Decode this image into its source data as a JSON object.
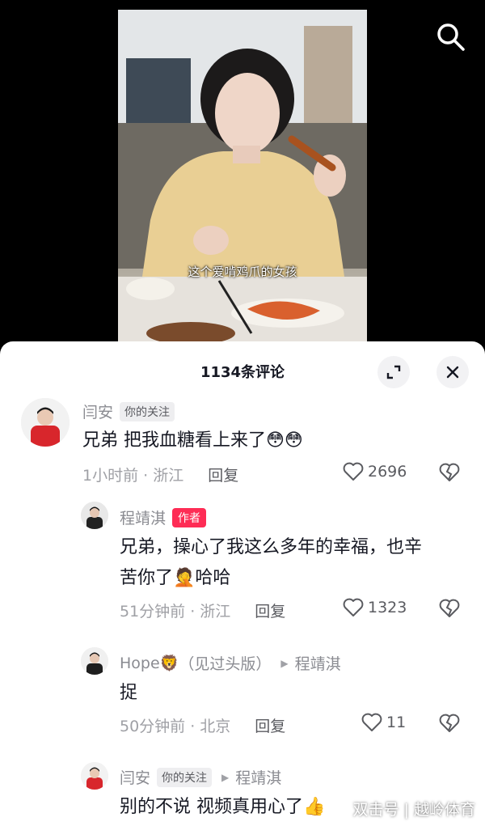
{
  "video": {
    "caption": "这个爱啃鸡爪的女孩"
  },
  "header": {
    "title": "1134条评论"
  },
  "comments": [
    {
      "author": "闫安",
      "tag": "你的关注",
      "text": "兄弟 把我血糖看上来了😳😳",
      "time_location": "1小时前 · 浙江",
      "reply_label": "回复",
      "likes": "2696"
    },
    {
      "author": "程靖淇",
      "tag": "作者",
      "text_line1": "兄弟，操心了我这么多年的幸福，也辛",
      "text_line2": "苦你了🤦哈哈",
      "time_location": "51分钟前 · 浙江",
      "reply_label": "回复",
      "likes": "1323"
    },
    {
      "author": "Hope🦁",
      "author_suffix": "（见过头版）",
      "reply_to": "程靖淇",
      "text": "捉",
      "time_location": "50分钟前 · 北京",
      "reply_label": "回复",
      "likes": "11"
    },
    {
      "author": "闫安",
      "tag": "你的关注",
      "reply_to": "程靖淇",
      "text": "别的不说 视频真用心了👍"
    }
  ],
  "watermark": "双击号 | 越岭体育",
  "colors": {
    "author_tag": "#fe2c55",
    "panel_bg": "#ffffff",
    "text_primary": "#161823",
    "text_secondary": "#8a8b91"
  }
}
